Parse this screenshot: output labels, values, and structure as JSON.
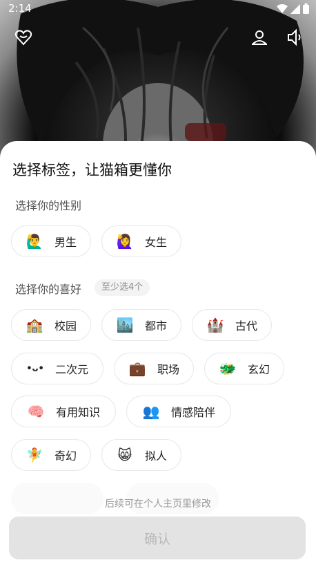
{
  "status_bar": {
    "time": "2:14",
    "icons": [
      "wifi-icon",
      "signal-icon",
      "battery-icon"
    ]
  },
  "overlay_icons": [
    "heart-icon",
    "profile-icon",
    "volume-icon"
  ],
  "sheet": {
    "title": "选择标签，让猫箱更懂你",
    "gender_section": {
      "label": "选择你的性别",
      "options": [
        {
          "emoji": "🙋‍♂️",
          "label": "男生"
        },
        {
          "emoji": "🙋‍♀️",
          "label": "女生"
        }
      ]
    },
    "interest_section": {
      "label": "选择你的喜好",
      "hint": "至少选4个",
      "options": [
        {
          "emoji": "🏫",
          "label": "校园"
        },
        {
          "emoji": "🏙️",
          "label": "都市"
        },
        {
          "emoji": "🏰",
          "label": "古代"
        },
        {
          "emoji": "•ᴗ•",
          "label": "二次元"
        },
        {
          "emoji": "💼",
          "label": "职场"
        },
        {
          "emoji": "🐲",
          "label": "玄幻"
        },
        {
          "emoji": "🧠",
          "label": "有用知识"
        },
        {
          "emoji": "👥",
          "label": "情感陪伴"
        },
        {
          "emoji": "🧚",
          "label": "奇幻"
        },
        {
          "emoji": "😸",
          "label": "拟人"
        }
      ]
    },
    "footer_hint": "后续可在个人主页里修改",
    "confirm_label": "确认"
  },
  "colors": {
    "sheet_bg": "#ffffff",
    "confirm_bg": "#e3e3e3",
    "confirm_text": "#b9b9b9"
  }
}
